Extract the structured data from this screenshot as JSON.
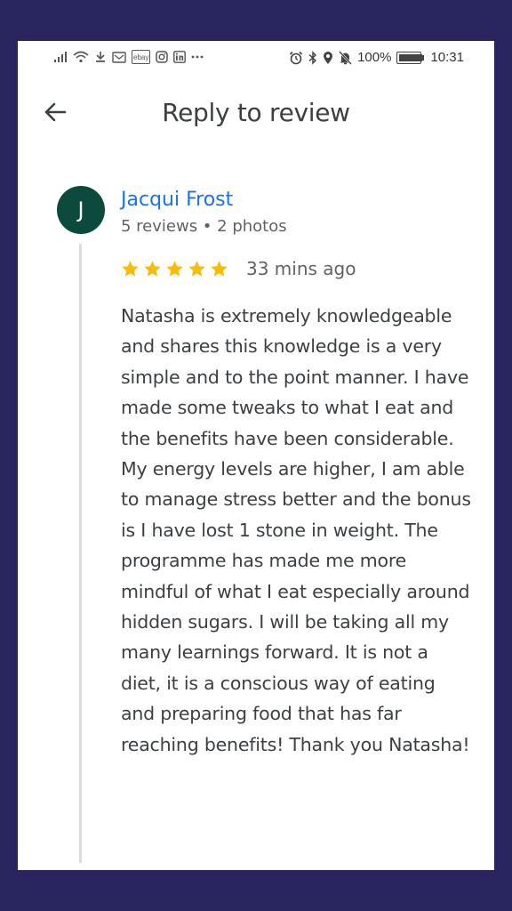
{
  "status_bar": {
    "left_icons": [
      "signal-icon",
      "wifi-icon",
      "download-icon",
      "notification-icon",
      "ebay-icon",
      "instagram-icon",
      "linkedin-icon",
      "more-icon"
    ],
    "battery_percent": "100%",
    "battery_level": 1.0,
    "time": "10:31",
    "right_icons": [
      "alarm-icon",
      "bluetooth-icon",
      "location-icon",
      "mute-icon",
      "battery-icon"
    ]
  },
  "header": {
    "title": "Reply to review",
    "back_icon": "arrow-back-icon"
  },
  "review": {
    "avatar_initial": "J",
    "avatar_color": "#0c4a3e",
    "name": "Jacqui Frost",
    "meta": "5 reviews • 2 photos",
    "rating": 5,
    "max_rating": 5,
    "star_color": "#fbbc04",
    "time_ago": "33 mins ago",
    "text": "Natasha is extremely knowledgeable and shares this knowledge is a very simple and to the point manner. I have made some tweaks to what I eat and the benefits have been considerable. My energy levels are higher, I am able to manage stress better and the bonus is I have lost 1 stone in weight. The programme has made me more mindful of what I eat especially around hidden sugars. I will be taking all my many learnings forward. It is not a diet, it is a conscious way of eating and preparing food that has far reaching benefits! Thank you Natasha!"
  },
  "colors": {
    "frame": "#29265f",
    "name_link": "#1a73e8"
  }
}
